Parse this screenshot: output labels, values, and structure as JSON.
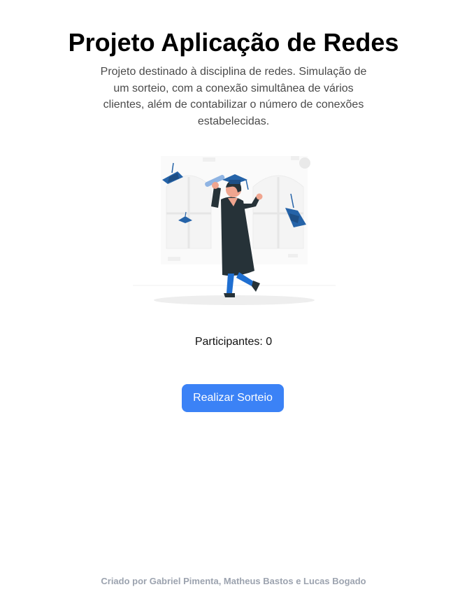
{
  "header": {
    "title": "Projeto Aplicação de Redes",
    "description": "Projeto destinado à disciplina de redes. Simulação de um sorteio, com a conexão simultânea de vários clientes, além de contabilizar o número de conexões estabelecidas."
  },
  "illustration": {
    "icon": "graduation-illustration",
    "colors": {
      "accent": "#2563a8",
      "gown": "#263238",
      "pants": "#1f6fd1",
      "skin": "#f0a58f",
      "background": "#f2f2f2"
    }
  },
  "status": {
    "participants_text": "Participantes: 0"
  },
  "actions": {
    "draw_label": "Realizar Sorteio",
    "button_color": "#3b82f6"
  },
  "footer": {
    "credits": "Criado por Gabriel Pimenta, Matheus Bastos e Lucas Bogado"
  }
}
